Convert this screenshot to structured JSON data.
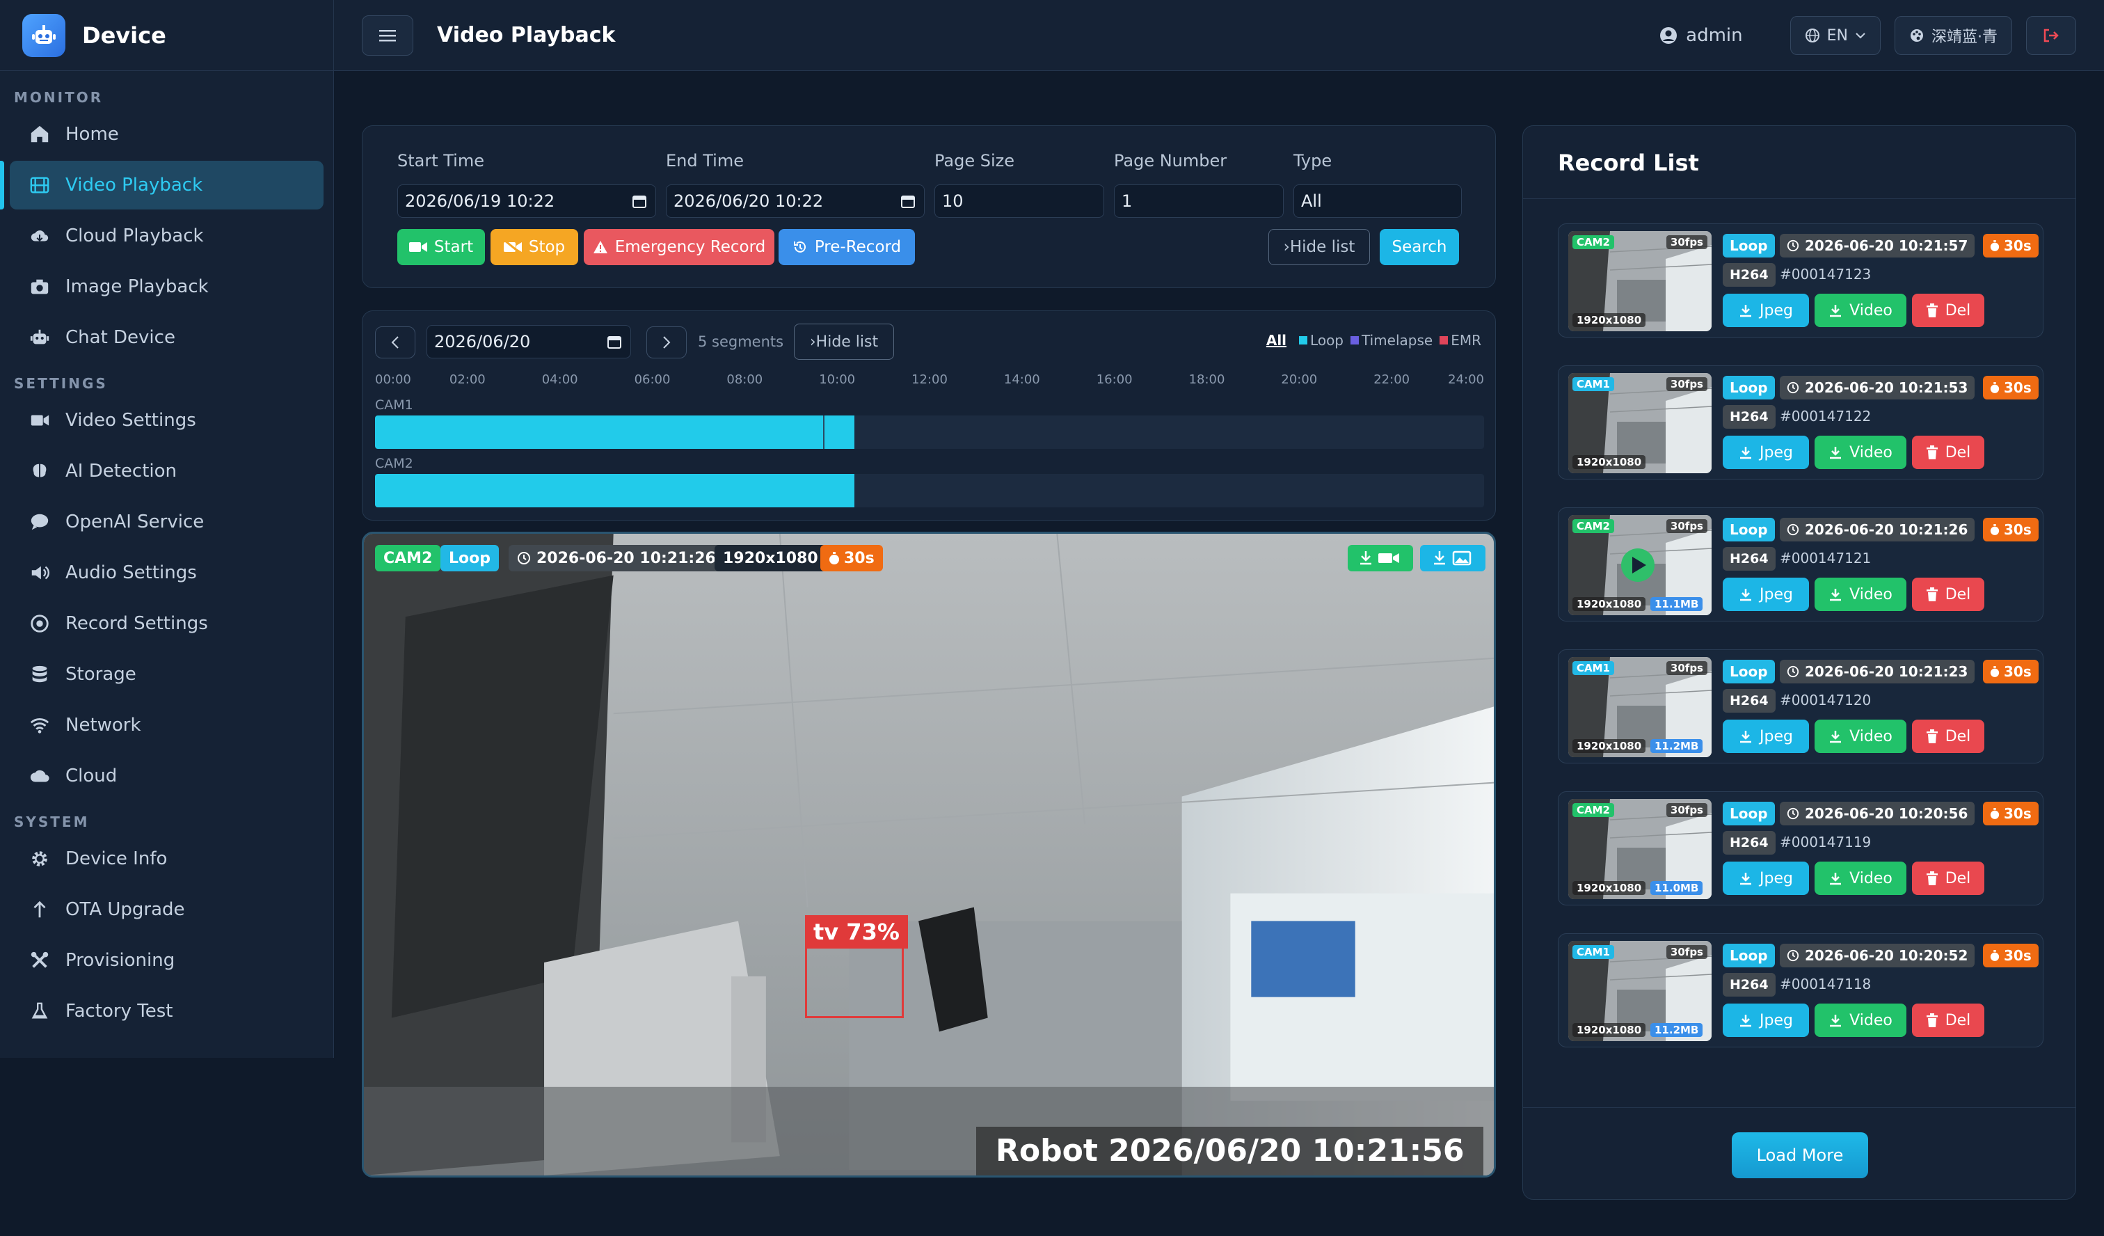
{
  "app": {
    "name": "Device"
  },
  "sidebar": {
    "sections": [
      {
        "label": "MONITOR",
        "items": [
          {
            "label": "Home",
            "icon": "home-icon"
          },
          {
            "label": "Video Playback",
            "icon": "film-icon",
            "active": true
          },
          {
            "label": "Cloud Playback",
            "icon": "cloud-download-icon"
          },
          {
            "label": "Image Playback",
            "icon": "camera-icon"
          },
          {
            "label": "Chat Device",
            "icon": "robot-icon"
          }
        ]
      },
      {
        "label": "SETTINGS",
        "items": [
          {
            "label": "Video Settings",
            "icon": "video-icon"
          },
          {
            "label": "AI Detection",
            "icon": "brain-icon"
          },
          {
            "label": "OpenAI Service",
            "icon": "chat-icon"
          },
          {
            "label": "Audio Settings",
            "icon": "speaker-icon"
          },
          {
            "label": "Record Settings",
            "icon": "record-icon"
          },
          {
            "label": "Storage",
            "icon": "database-icon"
          },
          {
            "label": "Network",
            "icon": "wifi-icon"
          },
          {
            "label": "Cloud",
            "icon": "cloud-icon"
          }
        ]
      },
      {
        "label": "SYSTEM",
        "items": [
          {
            "label": "Device Info",
            "icon": "cog-icon"
          },
          {
            "label": "OTA Upgrade",
            "icon": "arrow-up-icon"
          },
          {
            "label": "Provisioning",
            "icon": "tools-icon"
          },
          {
            "label": "Factory Test",
            "icon": "flask-icon"
          }
        ]
      }
    ]
  },
  "topbar": {
    "title": "Video Playback",
    "user": "admin",
    "lang": "EN",
    "theme": "深靖蓝·青"
  },
  "filter": {
    "start_label": "Start Time",
    "start_value": "2026/06/19 10:22",
    "end_label": "End Time",
    "end_value": "2026/06/20 10:22",
    "page_size_label": "Page Size",
    "page_size_value": "10",
    "page_number_label": "Page Number",
    "page_number_value": "1",
    "type_label": "Type",
    "type_value": "All",
    "start_btn": "Start",
    "stop_btn": "Stop",
    "emergency_btn": "Emergency Record",
    "prerecord_btn": "Pre-Record",
    "hide_btn": "›Hide list",
    "search_btn": "Search"
  },
  "timeline": {
    "date": "2026/06/20",
    "segments": "5 segments",
    "hide_btn": "›Hide list",
    "legend": {
      "all": "All",
      "loop": "Loop",
      "timelapse": "Timelapse",
      "emr": "EMR"
    },
    "ticks": [
      "00:00",
      "02:00",
      "04:00",
      "06:00",
      "08:00",
      "10:00",
      "12:00",
      "14:00",
      "16:00",
      "18:00",
      "20:00",
      "22:00",
      "24:00"
    ],
    "cameras": [
      {
        "name": "CAM1",
        "start_h": 0,
        "end_h": 10.37,
        "cursor_h": 9.7
      },
      {
        "name": "CAM2",
        "start_h": 0,
        "end_h": 10.37
      }
    ]
  },
  "player": {
    "cam": "CAM2",
    "type": "Loop",
    "time": "2026-06-20 10:21:26",
    "resolution": "1920x1080",
    "duration": "30s",
    "detection": "tv 73%",
    "overlay": "Robot  2026/06/20 10:21:56"
  },
  "records": {
    "title": "Record List",
    "load_more": "Load More",
    "jpeg_btn": "Jpeg",
    "video_btn": "Video",
    "del_btn": "Del",
    "items": [
      {
        "cam": "CAM2",
        "fps": "30fps",
        "res": "1920x1080",
        "size": "",
        "type": "Loop",
        "time": "2026-06-20 10:21:57",
        "dur": "30s",
        "codec": "H264",
        "id": "#000147123"
      },
      {
        "cam": "CAM1",
        "fps": "30fps",
        "res": "1920x1080",
        "size": "",
        "type": "Loop",
        "time": "2026-06-20 10:21:53",
        "dur": "30s",
        "codec": "H264",
        "id": "#000147122"
      },
      {
        "cam": "CAM2",
        "fps": "30fps",
        "res": "1920x1080",
        "size": "11.1MB",
        "type": "Loop",
        "time": "2026-06-20 10:21:26",
        "dur": "30s",
        "codec": "H264",
        "id": "#000147121",
        "playing": true
      },
      {
        "cam": "CAM1",
        "fps": "30fps",
        "res": "1920x1080",
        "size": "11.2MB",
        "type": "Loop",
        "time": "2026-06-20 10:21:23",
        "dur": "30s",
        "codec": "H264",
        "id": "#000147120"
      },
      {
        "cam": "CAM2",
        "fps": "30fps",
        "res": "1920x1080",
        "size": "11.0MB",
        "type": "Loop",
        "time": "2026-06-20 10:20:56",
        "dur": "30s",
        "codec": "H264",
        "id": "#000147119"
      },
      {
        "cam": "CAM1",
        "fps": "30fps",
        "res": "1920x1080",
        "size": "11.2MB",
        "type": "Loop",
        "time": "2026-06-20 10:20:52",
        "dur": "30s",
        "codec": "H264",
        "id": "#000147118"
      }
    ]
  },
  "colors": {
    "accent": "#22c4ee",
    "green": "#22c26a",
    "orange": "#f5a623",
    "red": "#e9484f",
    "blue": "#3a8fea"
  }
}
